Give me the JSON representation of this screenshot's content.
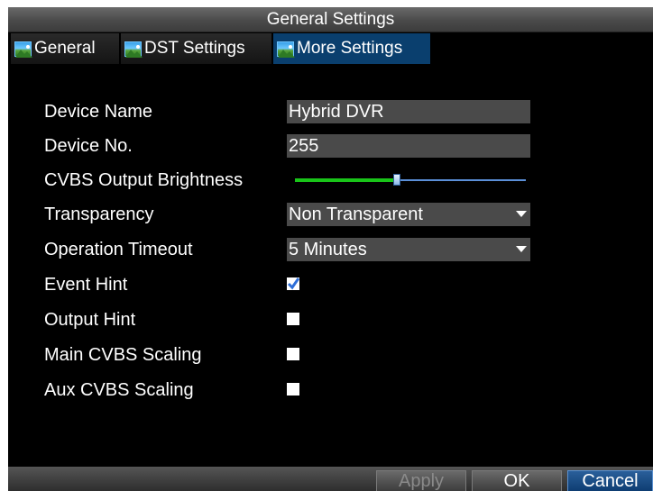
{
  "window": {
    "title": "General Settings"
  },
  "tabs": [
    {
      "label": "General",
      "icon": "landscape-icon",
      "active": false
    },
    {
      "label": "DST Settings",
      "icon": "landscape-icon",
      "active": false
    },
    {
      "label": "More Settings",
      "icon": "landscape-icon",
      "active": true
    }
  ],
  "fields": {
    "device_name": {
      "label": "Device Name",
      "value": "Hybrid DVR"
    },
    "device_no": {
      "label": "Device No.",
      "value": "255"
    },
    "cvbs_brightness": {
      "label": "CVBS Output Brightness",
      "level": 0.44
    },
    "transparency": {
      "label": "Transparency",
      "selected": "Non Transparent"
    },
    "operation_timeout": {
      "label": "Operation Timeout",
      "selected": "5 Minutes"
    },
    "event_hint": {
      "label": "Event Hint",
      "checked": true
    },
    "output_hint": {
      "label": "Output Hint",
      "checked": false
    },
    "main_cvbs_scaling": {
      "label": "Main CVBS Scaling",
      "checked": false
    },
    "aux_cvbs_scaling": {
      "label": "Aux CVBS Scaling",
      "checked": false
    }
  },
  "footer": {
    "apply_label": "Apply",
    "ok_label": "OK",
    "cancel_label": "Cancel"
  },
  "colors": {
    "background": "#000000",
    "field_bg": "#4a4a4a",
    "active_tab": "#0a3f6e",
    "slider_fill": "#19c419",
    "slider_track": "#5b8fd8",
    "check_mark": "#2f6fd8"
  }
}
